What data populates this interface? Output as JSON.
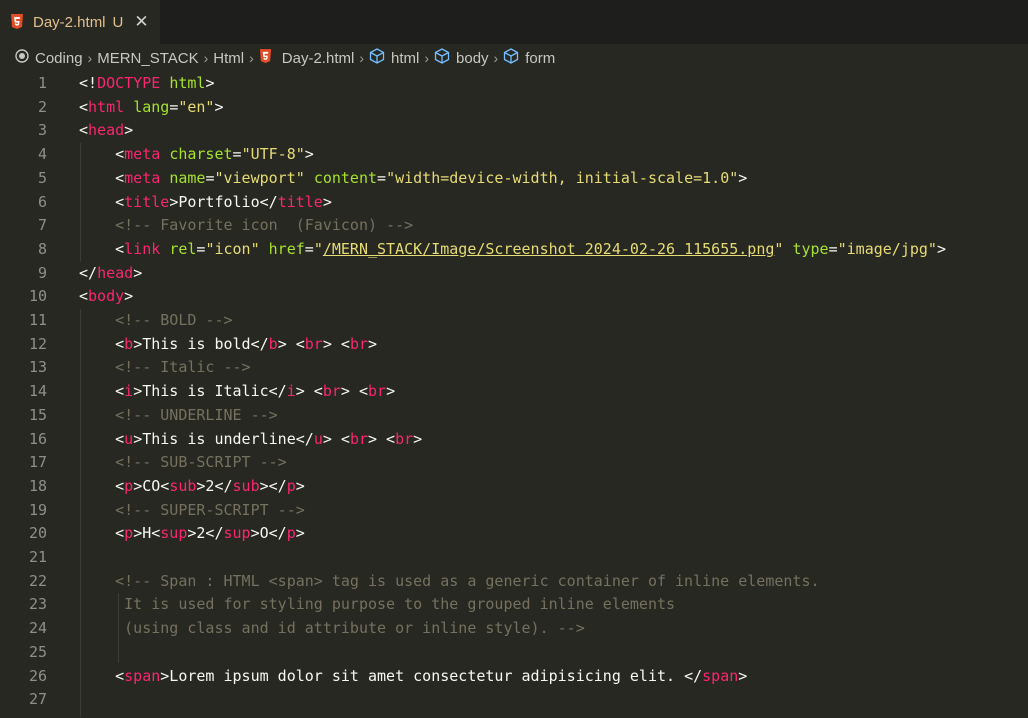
{
  "tab": {
    "filename": "Day-2.html",
    "status": "U",
    "close_icon": "close-icon"
  },
  "breadcrumb": {
    "items": [
      "Coding",
      "MERN_STACK",
      "Html",
      "Day-2.html",
      "html",
      "body",
      "form"
    ]
  },
  "colors": {
    "tag": "#f92672",
    "attr": "#a6e22e",
    "string": "#e6db74",
    "comment": "#75715e",
    "text": "#f8f8f2"
  },
  "lines": [
    {
      "n": "1",
      "s": [
        [
          "p",
          "<!"
        ],
        [
          "tag",
          "DOCTYPE"
        ],
        [
          "p",
          " "
        ],
        [
          "attr",
          "html"
        ],
        [
          "p",
          ">"
        ]
      ]
    },
    {
      "n": "2",
      "s": [
        [
          "p",
          "<"
        ],
        [
          "tag",
          "html"
        ],
        [
          "p",
          " "
        ],
        [
          "attr",
          "lang"
        ],
        [
          "p",
          "="
        ],
        [
          "str",
          "\"en\""
        ],
        [
          "p",
          ">"
        ]
      ]
    },
    {
      "n": "3",
      "s": [
        [
          "p",
          "<"
        ],
        [
          "tag",
          "head"
        ],
        [
          "p",
          ">"
        ]
      ]
    },
    {
      "n": "4",
      "s": [
        [
          "p",
          "    <"
        ],
        [
          "tag",
          "meta"
        ],
        [
          "p",
          " "
        ],
        [
          "attr",
          "charset"
        ],
        [
          "p",
          "="
        ],
        [
          "str",
          "\"UTF-8\""
        ],
        [
          "p",
          ">"
        ]
      ]
    },
    {
      "n": "5",
      "s": [
        [
          "p",
          "    <"
        ],
        [
          "tag",
          "meta"
        ],
        [
          "p",
          " "
        ],
        [
          "attr",
          "name"
        ],
        [
          "p",
          "="
        ],
        [
          "str",
          "\"viewport\""
        ],
        [
          "p",
          " "
        ],
        [
          "attr",
          "content"
        ],
        [
          "p",
          "="
        ],
        [
          "str",
          "\"width=device-width, initial-scale=1.0\""
        ],
        [
          "p",
          ">"
        ]
      ]
    },
    {
      "n": "6",
      "s": [
        [
          "p",
          "    <"
        ],
        [
          "tag",
          "title"
        ],
        [
          "p",
          ">Portfolio</"
        ],
        [
          "tag",
          "title"
        ],
        [
          "p",
          ">"
        ]
      ]
    },
    {
      "n": "7",
      "s": [
        [
          "com",
          "    <!-- Favorite icon  (Favicon) -->"
        ]
      ]
    },
    {
      "n": "8",
      "s": [
        [
          "p",
          "    <"
        ],
        [
          "tag",
          "link"
        ],
        [
          "p",
          " "
        ],
        [
          "attr",
          "rel"
        ],
        [
          "p",
          "="
        ],
        [
          "str",
          "\"icon\""
        ],
        [
          "p",
          " "
        ],
        [
          "attr",
          "href"
        ],
        [
          "p",
          "="
        ],
        [
          "str",
          "\""
        ],
        [
          "link",
          "/MERN_STACK/Image/Screenshot 2024-02-26 115655.png"
        ],
        [
          "str",
          "\""
        ],
        [
          "p",
          " "
        ],
        [
          "attr",
          "type"
        ],
        [
          "p",
          "="
        ],
        [
          "str",
          "\"image/jpg\""
        ],
        [
          "p",
          ">"
        ]
      ]
    },
    {
      "n": "9",
      "s": [
        [
          "p",
          "</"
        ],
        [
          "tag",
          "head"
        ],
        [
          "p",
          ">"
        ]
      ]
    },
    {
      "n": "10",
      "s": [
        [
          "p",
          "<"
        ],
        [
          "tag",
          "body"
        ],
        [
          "p",
          ">"
        ]
      ]
    },
    {
      "n": "11",
      "s": [
        [
          "com",
          "    <!-- BOLD -->"
        ]
      ]
    },
    {
      "n": "12",
      "s": [
        [
          "p",
          "    <"
        ],
        [
          "tag",
          "b"
        ],
        [
          "p",
          ">This is bold</"
        ],
        [
          "tag",
          "b"
        ],
        [
          "p",
          "> <"
        ],
        [
          "tag",
          "br"
        ],
        [
          "p",
          "> <"
        ],
        [
          "tag",
          "br"
        ],
        [
          "p",
          ">"
        ]
      ]
    },
    {
      "n": "13",
      "s": [
        [
          "com",
          "    <!-- Italic -->"
        ]
      ]
    },
    {
      "n": "14",
      "s": [
        [
          "p",
          "    <"
        ],
        [
          "tag",
          "i"
        ],
        [
          "p",
          ">This is Italic</"
        ],
        [
          "tag",
          "i"
        ],
        [
          "p",
          "> <"
        ],
        [
          "tag",
          "br"
        ],
        [
          "p",
          "> <"
        ],
        [
          "tag",
          "br"
        ],
        [
          "p",
          ">"
        ]
      ]
    },
    {
      "n": "15",
      "s": [
        [
          "com",
          "    <!-- UNDERLINE -->"
        ]
      ]
    },
    {
      "n": "16",
      "s": [
        [
          "p",
          "    <"
        ],
        [
          "tag",
          "u"
        ],
        [
          "p",
          ">This is underline</"
        ],
        [
          "tag",
          "u"
        ],
        [
          "p",
          "> <"
        ],
        [
          "tag",
          "br"
        ],
        [
          "p",
          "> <"
        ],
        [
          "tag",
          "br"
        ],
        [
          "p",
          ">"
        ]
      ]
    },
    {
      "n": "17",
      "s": [
        [
          "com",
          "    <!-- SUB-SCRIPT -->"
        ]
      ]
    },
    {
      "n": "18",
      "s": [
        [
          "p",
          "    <"
        ],
        [
          "tag",
          "p"
        ],
        [
          "p",
          ">CO<"
        ],
        [
          "tag",
          "sub"
        ],
        [
          "p",
          ">2</"
        ],
        [
          "tag",
          "sub"
        ],
        [
          "p",
          "></"
        ],
        [
          "tag",
          "p"
        ],
        [
          "p",
          ">"
        ]
      ]
    },
    {
      "n": "19",
      "s": [
        [
          "com",
          "    <!-- SUPER-SCRIPT -->"
        ]
      ]
    },
    {
      "n": "20",
      "s": [
        [
          "p",
          "    <"
        ],
        [
          "tag",
          "p"
        ],
        [
          "p",
          ">H<"
        ],
        [
          "tag",
          "sup"
        ],
        [
          "p",
          ">2</"
        ],
        [
          "tag",
          "sup"
        ],
        [
          "p",
          ">O</"
        ],
        [
          "tag",
          "p"
        ],
        [
          "p",
          ">"
        ]
      ]
    },
    {
      "n": "21",
      "s": []
    },
    {
      "n": "22",
      "s": [
        [
          "com",
          "    <!-- Span : HTML <span> tag is used as a generic container of inline elements."
        ]
      ]
    },
    {
      "n": "23",
      "s": [
        [
          "com",
          "     It is used for styling purpose to the grouped inline elements"
        ]
      ]
    },
    {
      "n": "24",
      "s": [
        [
          "com",
          "     (using class and id attribute or inline style). -->"
        ]
      ]
    },
    {
      "n": "25",
      "s": []
    },
    {
      "n": "26",
      "s": [
        [
          "p",
          "    <"
        ],
        [
          "tag",
          "span"
        ],
        [
          "p",
          ">Lorem ipsum dolor sit amet consectetur adipisicing elit. </"
        ],
        [
          "tag",
          "span"
        ],
        [
          "p",
          ">"
        ]
      ]
    },
    {
      "n": "27",
      "s": []
    }
  ]
}
